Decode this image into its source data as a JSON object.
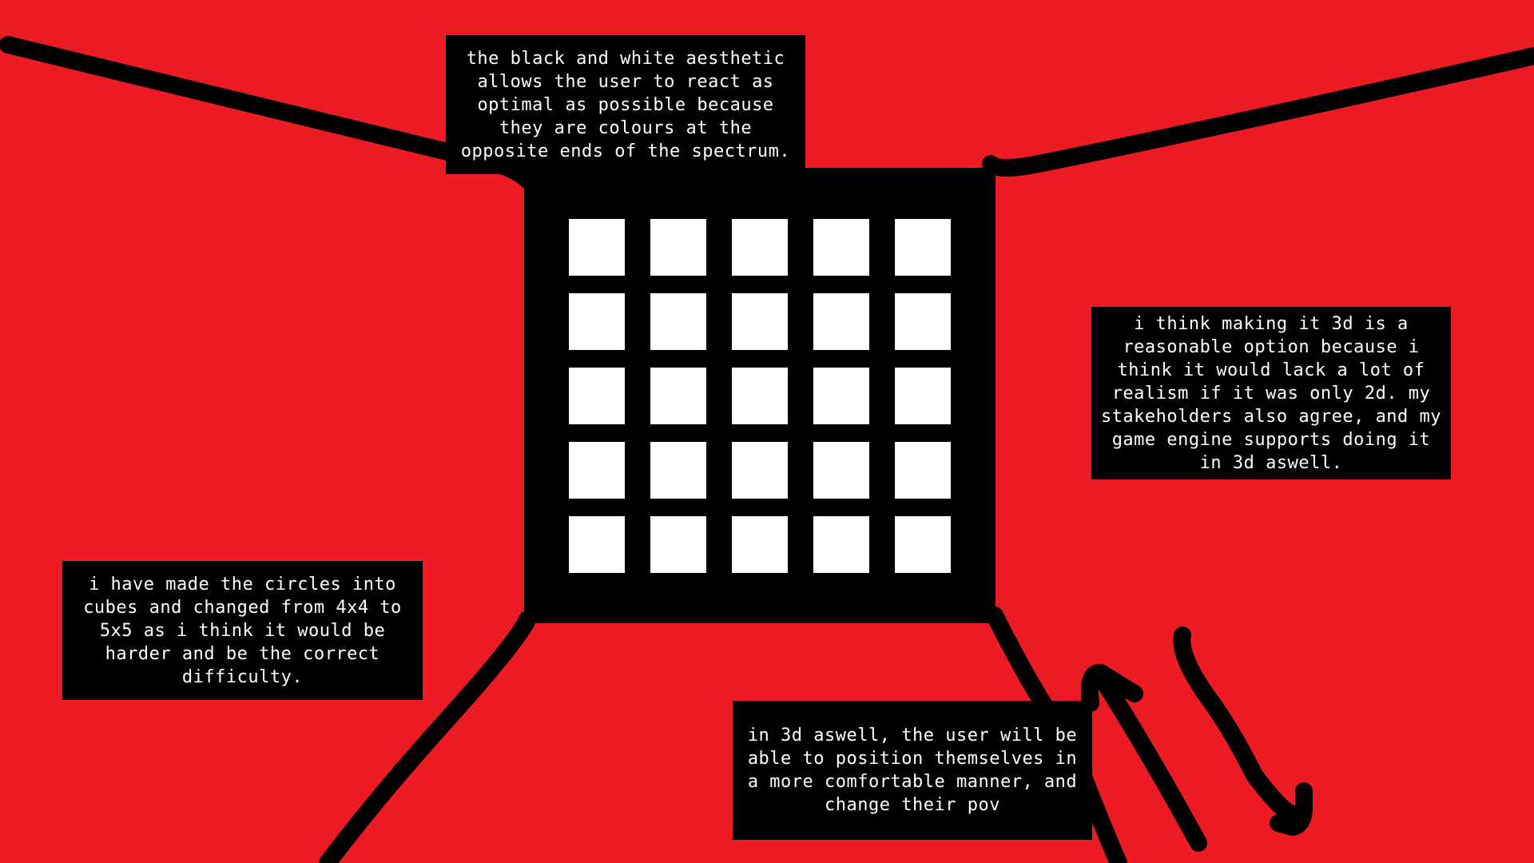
{
  "colors": {
    "background": "#ED1C24",
    "panel": "#000000",
    "cell": "#FFFFFF",
    "text": "#FFFFFF"
  },
  "grid": {
    "rows": 5,
    "cols": 5
  },
  "notes": {
    "aesthetic": "the black and white aesthetic allows the user to react as optimal as possible because they are colours at the opposite ends of the spectrum.",
    "three_d": "i think making it 3d is a reasonable option because i think it would lack a lot of realism if it was only 2d. my stakeholders also agree, and my game engine supports doing it in 3d aswell.",
    "cubes": "i have made the circles into cubes and changed from 4x4 to 5x5 as i think it would be harder and be the correct difficulty.",
    "pov": "in 3d aswell, the user will be able to position themselves in a more comfortable manner, and change their pov"
  }
}
